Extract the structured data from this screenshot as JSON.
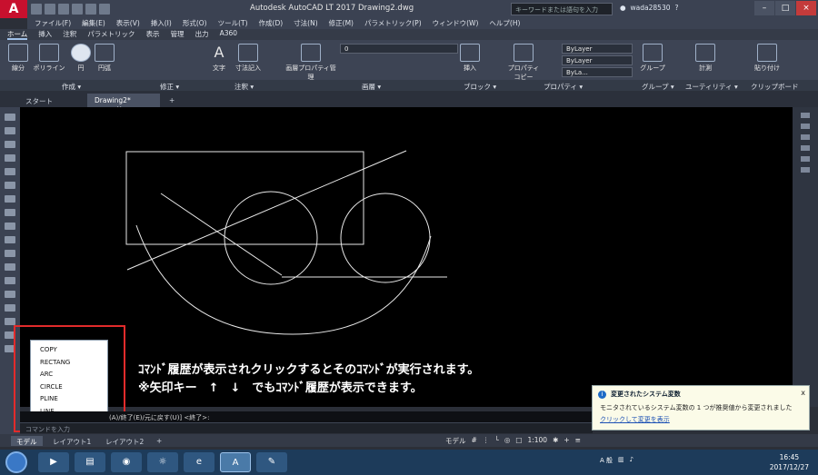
{
  "window": {
    "title": "Autodesk AutoCAD LT 2017      Drawing2.dwg",
    "search_placeholder": "キーワードまたは語句を入力",
    "user": "wada28530",
    "help": "?"
  },
  "menubar": [
    "ファイル(F)",
    "編集(E)",
    "表示(V)",
    "挿入(I)",
    "形式(O)",
    "ツール(T)",
    "作成(D)",
    "寸法(N)",
    "修正(M)",
    "パラメトリック(P)",
    "ウィンドウ(W)",
    "ヘルプ(H)"
  ],
  "ribbon_tabs": [
    "ホーム",
    "挿入",
    "注釈",
    "パラメトリック",
    "表示",
    "管理",
    "出力",
    "A360"
  ],
  "ribbon_tools": {
    "line": "線分",
    "polyline": "ポリライン",
    "circle": "円",
    "arc": "円弧",
    "text": "文字",
    "dimension": "寸法記入",
    "layer_props": "画層プロパティ管理",
    "layer_value": "0",
    "insert": "挿入",
    "properties": "プロパティコピー",
    "bylayer1": "ByLayer",
    "bylayer2": "ByLayer",
    "bylayer3": "ByLa...",
    "group": "グループ",
    "measure": "計測",
    "paste": "貼り付け"
  },
  "ribbon_panels": [
    "作成 ▾",
    "修正 ▾",
    "注釈 ▾",
    "画層 ▾",
    "ブロック ▾",
    "プロパティ ▾",
    "グループ ▾",
    "ユーティリティ ▾",
    "クリップボード"
  ],
  "doc_tabs": {
    "start": "スタート",
    "drawing": "Drawing2*",
    "close": "×",
    "add": "+"
  },
  "command_history": {
    "items": [
      "COPY",
      "RECTANG",
      "ARC",
      "CIRCLE",
      "PLINE",
      "LINE"
    ]
  },
  "annotation": {
    "line1": "ｺﾏﾝﾄﾞ履歴が表示されクリックするとそのｺﾏﾝﾄﾞが実行されます。",
    "line2": "※矢印キー　↑　↓　でもｺﾏﾝﾄﾞ履歴が表示できます。"
  },
  "command_line": {
    "history_text": "(A)/終了(E)/元に戻す(U)] <終了>:",
    "input_placeholder": "コマンドを入力"
  },
  "layout_tabs": [
    "モデル",
    "レイアウト1",
    "レイアウト2",
    "+"
  ],
  "status": {
    "model": "モデル",
    "scale": "1:100"
  },
  "notification": {
    "title": "変更されたシステム変数",
    "message": "モニタされているシステム変数の 1 つが推奨値から変更されました",
    "link": "クリックして変更を表示",
    "close": "x"
  },
  "taskbar": {
    "ime": "A 般",
    "time": "16:45",
    "date": "2017/12/27"
  },
  "colors": {
    "accent": "#c8102e",
    "canvas": "#000000",
    "highlight": "#e22b2b"
  }
}
